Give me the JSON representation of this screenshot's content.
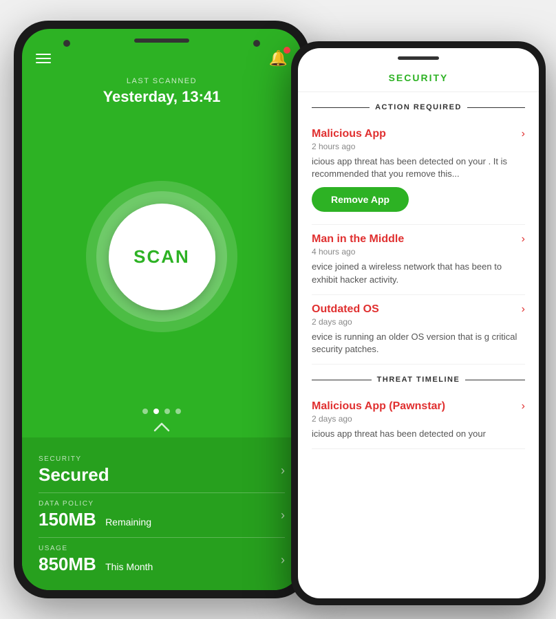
{
  "left_phone": {
    "last_scanned_label": "LAST SCANNED",
    "last_scanned_value": "Yesterday, 13:41",
    "scan_button_label": "SCAN",
    "dots": [
      false,
      true,
      false,
      false
    ],
    "stats": [
      {
        "label": "SECURITY",
        "value_bold": "Secured",
        "value_sub": "",
        "arrow": "›"
      },
      {
        "label": "DATA POLICY",
        "value_bold": "150MB",
        "value_sub": "Remaining",
        "arrow": "›"
      },
      {
        "label": "USAGE",
        "value_bold": "850MB",
        "value_sub": "This Month",
        "arrow": "›"
      }
    ]
  },
  "right_phone": {
    "header_title": "SECURITY",
    "action_required_label": "ACTION REQUIRED",
    "threats": [
      {
        "title": "Malicious App",
        "time": "2 hours ago",
        "description": "icious app threat has been detected on your . It is recommended that you remove this...",
        "has_remove_button": true,
        "remove_label": "Remove App"
      },
      {
        "title": "Man in the Middle",
        "time": "4 hours ago",
        "description": "evice joined a wireless network that has been to exhibit hacker activity.",
        "has_remove_button": false,
        "remove_label": ""
      },
      {
        "title": "Outdated OS",
        "time": "2 days ago",
        "description": "evice is running an older OS version that is g critical security patches.",
        "has_remove_button": false,
        "remove_label": ""
      }
    ],
    "threat_timeline_label": "THREAT TIMELINE",
    "timeline_threats": [
      {
        "title": "Malicious App (Pawnstar)",
        "time": "2 days ago",
        "description": "icious app threat has been detected on your"
      }
    ]
  },
  "colors": {
    "green": "#2db224",
    "dark_green": "#27a01e",
    "red": "#e03030"
  }
}
